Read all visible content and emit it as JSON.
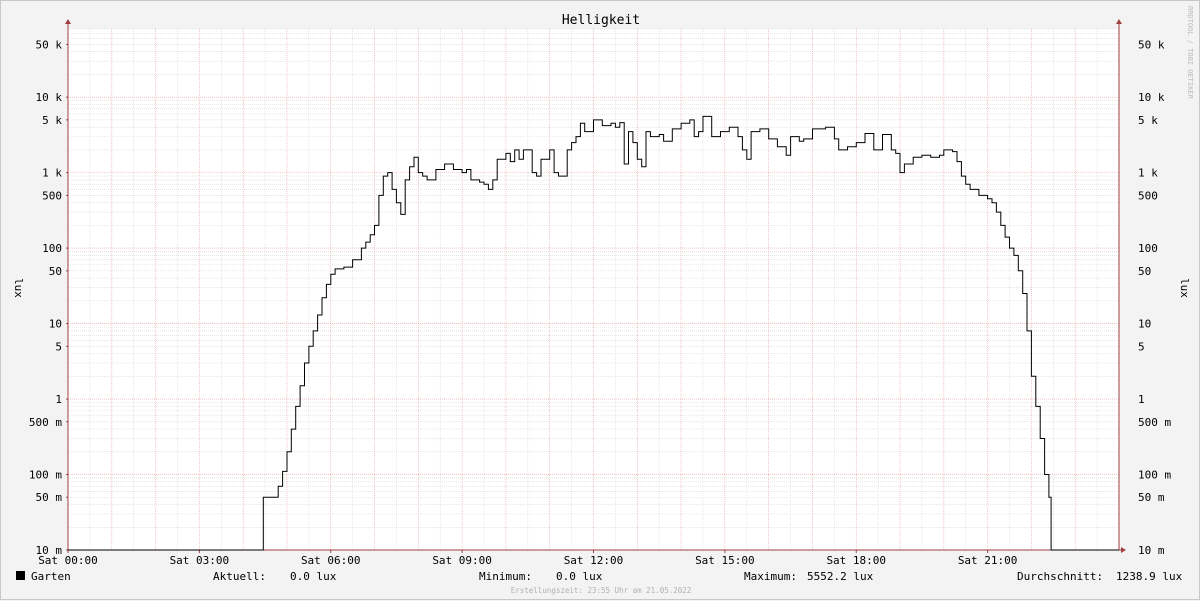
{
  "chart_data": {
    "type": "line",
    "title": "Helligkeit",
    "ylabel": "lux",
    "y_scale": "log",
    "ylim": [
      0.01,
      80000
    ],
    "xlim": [
      0,
      24
    ],
    "x_tick_labels": [
      {
        "hour": 0,
        "label": "Sat 00:00"
      },
      {
        "hour": 3,
        "label": "Sat 03:00"
      },
      {
        "hour": 6,
        "label": "Sat 06:00"
      },
      {
        "hour": 9,
        "label": "Sat 09:00"
      },
      {
        "hour": 12,
        "label": "Sat 12:00"
      },
      {
        "hour": 15,
        "label": "Sat 15:00"
      },
      {
        "hour": 18,
        "label": "Sat 18:00"
      },
      {
        "hour": 21,
        "label": "Sat 21:00"
      }
    ],
    "y_tick_labels": [
      {
        "value": 0.01,
        "label": "10 m"
      },
      {
        "value": 0.05,
        "label": "50 m"
      },
      {
        "value": 0.1,
        "label": "100 m"
      },
      {
        "value": 0.5,
        "label": "500 m"
      },
      {
        "value": 1,
        "label": "1"
      },
      {
        "value": 5,
        "label": "5"
      },
      {
        "value": 10,
        "label": "10"
      },
      {
        "value": 50,
        "label": "50"
      },
      {
        "value": 100,
        "label": "100"
      },
      {
        "value": 500,
        "label": "500"
      },
      {
        "value": 1000,
        "label": "1 k"
      },
      {
        "value": 5000,
        "label": "5 k"
      },
      {
        "value": 10000,
        "label": "10 k"
      },
      {
        "value": 50000,
        "label": "50 k"
      }
    ],
    "series": [
      {
        "name": "Garten",
        "color": "#000000",
        "points": [
          [
            0,
            0.01
          ],
          [
            4.45,
            0.01
          ],
          [
            4.46,
            0.05
          ],
          [
            4.75,
            0.05
          ],
          [
            4.8,
            0.07
          ],
          [
            4.9,
            0.11
          ],
          [
            5.0,
            0.2
          ],
          [
            5.1,
            0.4
          ],
          [
            5.2,
            0.8
          ],
          [
            5.3,
            1.5
          ],
          [
            5.4,
            3
          ],
          [
            5.5,
            5
          ],
          [
            5.6,
            8
          ],
          [
            5.7,
            13
          ],
          [
            5.8,
            22
          ],
          [
            5.9,
            33
          ],
          [
            6.0,
            45
          ],
          [
            6.1,
            53
          ],
          [
            6.3,
            56
          ],
          [
            6.5,
            70
          ],
          [
            6.7,
            100
          ],
          [
            6.8,
            120
          ],
          [
            6.9,
            150
          ],
          [
            7.0,
            200
          ],
          [
            7.1,
            500
          ],
          [
            7.2,
            900
          ],
          [
            7.3,
            1000
          ],
          [
            7.4,
            600
          ],
          [
            7.5,
            400
          ],
          [
            7.6,
            280
          ],
          [
            7.7,
            800
          ],
          [
            7.8,
            1200
          ],
          [
            7.9,
            1600
          ],
          [
            8.0,
            1000
          ],
          [
            8.1,
            900
          ],
          [
            8.2,
            800
          ],
          [
            8.4,
            1100
          ],
          [
            8.6,
            1300
          ],
          [
            8.8,
            1100
          ],
          [
            9.0,
            1000
          ],
          [
            9.1,
            1100
          ],
          [
            9.2,
            800
          ],
          [
            9.4,
            750
          ],
          [
            9.5,
            700
          ],
          [
            9.6,
            600
          ],
          [
            9.7,
            800
          ],
          [
            9.8,
            1500
          ],
          [
            10.0,
            1800
          ],
          [
            10.1,
            1400
          ],
          [
            10.2,
            2000
          ],
          [
            10.3,
            1500
          ],
          [
            10.4,
            2000
          ],
          [
            10.6,
            1000
          ],
          [
            10.7,
            900
          ],
          [
            10.8,
            1500
          ],
          [
            11.0,
            2000
          ],
          [
            11.1,
            1000
          ],
          [
            11.2,
            900
          ],
          [
            11.4,
            2000
          ],
          [
            11.5,
            2500
          ],
          [
            11.6,
            3000
          ],
          [
            11.7,
            4500
          ],
          [
            11.8,
            3500
          ],
          [
            12.0,
            5000
          ],
          [
            12.2,
            4200
          ],
          [
            12.4,
            4500
          ],
          [
            12.5,
            4000
          ],
          [
            12.6,
            4600
          ],
          [
            12.7,
            1300
          ],
          [
            12.8,
            3500
          ],
          [
            12.9,
            2500
          ],
          [
            13.0,
            1500
          ],
          [
            13.1,
            1200
          ],
          [
            13.2,
            3500
          ],
          [
            13.3,
            3000
          ],
          [
            13.5,
            3200
          ],
          [
            13.6,
            2600
          ],
          [
            13.8,
            3800
          ],
          [
            14.0,
            4500
          ],
          [
            14.2,
            5000
          ],
          [
            14.3,
            3000
          ],
          [
            14.4,
            3500
          ],
          [
            14.5,
            5552
          ],
          [
            14.7,
            3000
          ],
          [
            14.9,
            3500
          ],
          [
            15.1,
            4000
          ],
          [
            15.3,
            3000
          ],
          [
            15.4,
            2000
          ],
          [
            15.5,
            1500
          ],
          [
            15.6,
            3500
          ],
          [
            15.8,
            3800
          ],
          [
            16.0,
            2800
          ],
          [
            16.2,
            2200
          ],
          [
            16.4,
            1700
          ],
          [
            16.5,
            3000
          ],
          [
            16.7,
            2600
          ],
          [
            16.8,
            2800
          ],
          [
            17.0,
            3800
          ],
          [
            17.3,
            4000
          ],
          [
            17.5,
            2800
          ],
          [
            17.6,
            2000
          ],
          [
            17.8,
            2200
          ],
          [
            18.0,
            2500
          ],
          [
            18.2,
            3300
          ],
          [
            18.4,
            2000
          ],
          [
            18.6,
            3200
          ],
          [
            18.8,
            2000
          ],
          [
            18.9,
            1800
          ],
          [
            19.0,
            1000
          ],
          [
            19.1,
            1300
          ],
          [
            19.3,
            1600
          ],
          [
            19.5,
            1700
          ],
          [
            19.7,
            1600
          ],
          [
            19.9,
            1700
          ],
          [
            20.0,
            2000
          ],
          [
            20.2,
            1900
          ],
          [
            20.3,
            1400
          ],
          [
            20.4,
            900
          ],
          [
            20.5,
            700
          ],
          [
            20.6,
            600
          ],
          [
            20.8,
            500
          ],
          [
            21.0,
            450
          ],
          [
            21.1,
            400
          ],
          [
            21.2,
            300
          ],
          [
            21.3,
            200
          ],
          [
            21.4,
            140
          ],
          [
            21.5,
            100
          ],
          [
            21.6,
            80
          ],
          [
            21.7,
            50
          ],
          [
            21.8,
            25
          ],
          [
            21.9,
            8
          ],
          [
            22.0,
            2
          ],
          [
            22.1,
            0.8
          ],
          [
            22.2,
            0.3
          ],
          [
            22.3,
            0.1
          ],
          [
            22.4,
            0.05
          ],
          [
            22.45,
            0.01
          ],
          [
            24,
            0.01
          ]
        ]
      }
    ]
  },
  "legend": {
    "series_name": "Garten",
    "swatch_color": "#000000",
    "stats": {
      "current_label": "Aktuell:",
      "current_value": "0.0 lux",
      "min_label": "Minimum:",
      "min_value": "0.0 lux",
      "max_label": "Maximum:",
      "max_value": "5552.2 lux",
      "avg_label": "Durchschnitt:",
      "avg_value": "1238.9 lux"
    }
  },
  "footer_note": "Erstellungszeit: 23:55 Uhr am 21.05.2022",
  "watermark": "RRDTOOL / TOBI OETIKER",
  "colors": {
    "background": "#f3f3f3",
    "plot_background": "#ffffff",
    "major_grid": "#e8a0a0",
    "minor_grid": "#d8d8d8",
    "axis": "#a04040",
    "line": "#000000"
  }
}
